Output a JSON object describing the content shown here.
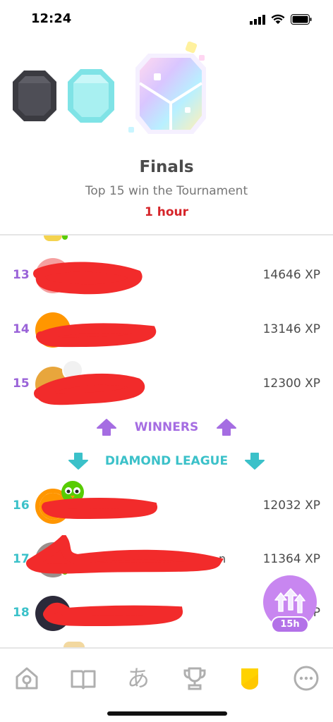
{
  "status_bar": {
    "time": "12:24"
  },
  "league": {
    "title": "Finals",
    "subtitle": "Top 15 win the Tournament",
    "time_left": "1 hour"
  },
  "rows": [
    {
      "rank": "13",
      "xp": "14646 XP",
      "zone": "promotion"
    },
    {
      "rank": "14",
      "xp": "13146 XP",
      "zone": "promotion"
    },
    {
      "rank": "15",
      "xp": "12300 XP",
      "zone": "promotion"
    },
    {
      "rank": "16",
      "xp": "12032 XP",
      "zone": "demotion"
    },
    {
      "rank": "17",
      "xp": "11364 XP",
      "zone": "demotion"
    },
    {
      "rank": "18",
      "xp": "",
      "xp_partial": "P",
      "zone": "demotion"
    }
  ],
  "partial_names": {
    "row17": "n"
  },
  "zones": {
    "winners": "WINNERS",
    "diamond": "DIAMOND LEAGUE"
  },
  "chest": {
    "timer": "15h"
  },
  "tabs": [
    {
      "icon": "home-icon"
    },
    {
      "icon": "book-icon"
    },
    {
      "icon": "character-icon",
      "glyph": "あ"
    },
    {
      "icon": "trophy-icon"
    },
    {
      "icon": "league-shield-icon"
    },
    {
      "icon": "more-icon"
    }
  ],
  "colors": {
    "promotion": "#9a63d8",
    "demotion": "#3bc1c9",
    "timer": "#d6252a",
    "chest": "#c886f0"
  }
}
